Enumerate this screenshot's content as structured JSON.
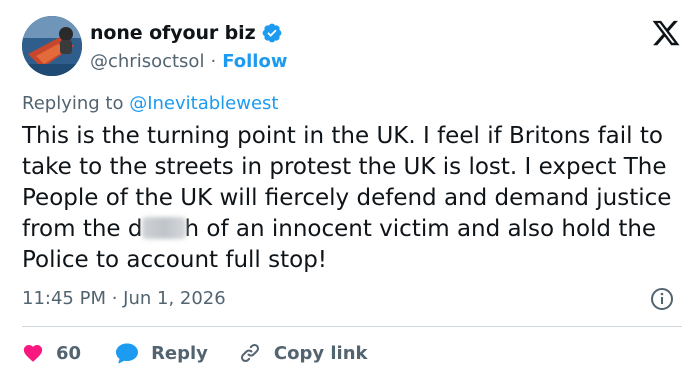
{
  "colors": {
    "accent": "#1d9bf0",
    "text": "#0f1419",
    "muted": "#536471",
    "like": "#f91880",
    "divider": "#cfd9de"
  },
  "author": {
    "display_name": "none ofyour biz",
    "handle": "@chrisoctsol",
    "separator": "·",
    "follow_label": "Follow",
    "verified_icon": "verified-badge-icon",
    "avatar_icon": "avatar-image"
  },
  "platform_logo": "x-logo-icon",
  "reply_context": {
    "prefix": "Replying to ",
    "mention": "@Inevitablewest"
  },
  "body": {
    "part1": "This is the turning point in the UK. I feel if Britons fail to take to the streets in protest the UK is lost. I expect The People of the UK will fiercely defend and demand justice from the d",
    "part2": "h of an innocent victim and also hold the Police to account full stop!"
  },
  "meta": {
    "timestamp": "11:45 PM · Jun 1, 2026",
    "info_icon": "info-icon"
  },
  "actions": {
    "like_count": "60",
    "reply_label": "Reply",
    "copy_label": "Copy link"
  }
}
